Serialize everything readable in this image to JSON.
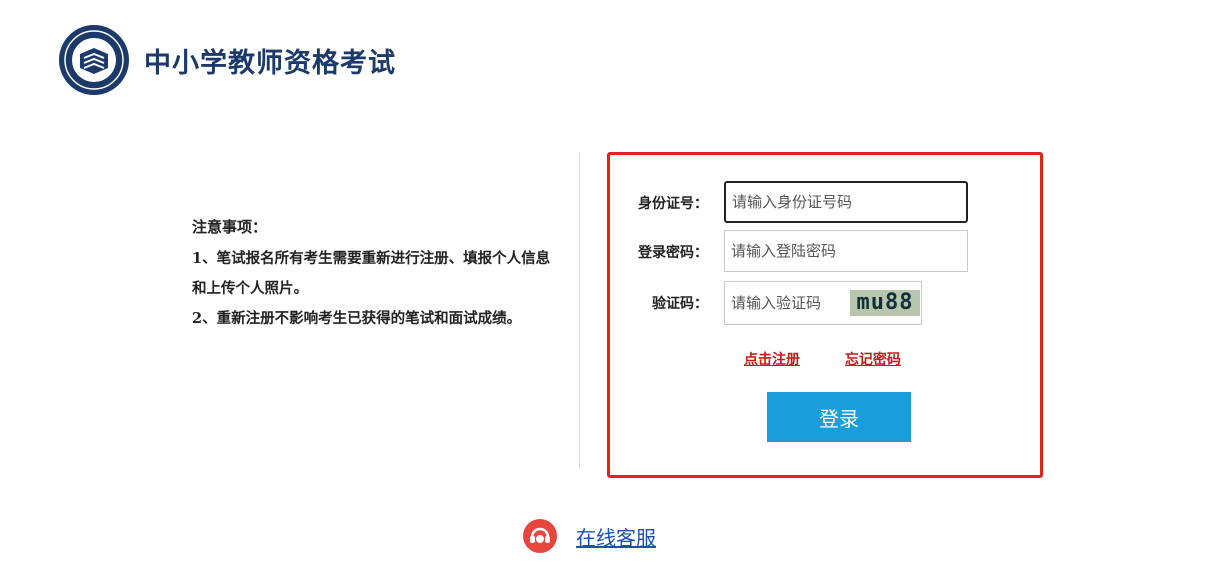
{
  "header": {
    "title": "中小学教师资格考试",
    "logo_icon": "ntce-emblem-icon",
    "brand_color": "#1b3a6b"
  },
  "notice": {
    "title": "注意事项：",
    "items": [
      "1、笔试报名所有考生需要重新进行注册、填报个人信息和上传个人照片。",
      "2、重新注册不影响考生已获得的笔试和面试成绩。"
    ]
  },
  "login": {
    "id_label": "身份证号：",
    "id_placeholder": "请输入身份证号码",
    "password_label": "登录密码：",
    "password_placeholder": "请输入登陆密码",
    "captcha_label": "验证码：",
    "captcha_placeholder": "请输入验证码",
    "captcha_text": "mu88",
    "register_link": "点击注册",
    "forgot_link": "忘记密码",
    "submit_label": "登录",
    "highlight_color": "#e2231a",
    "button_color": "#1a9ed9"
  },
  "service": {
    "label": "在线客服",
    "icon": "customer-service-icon"
  }
}
